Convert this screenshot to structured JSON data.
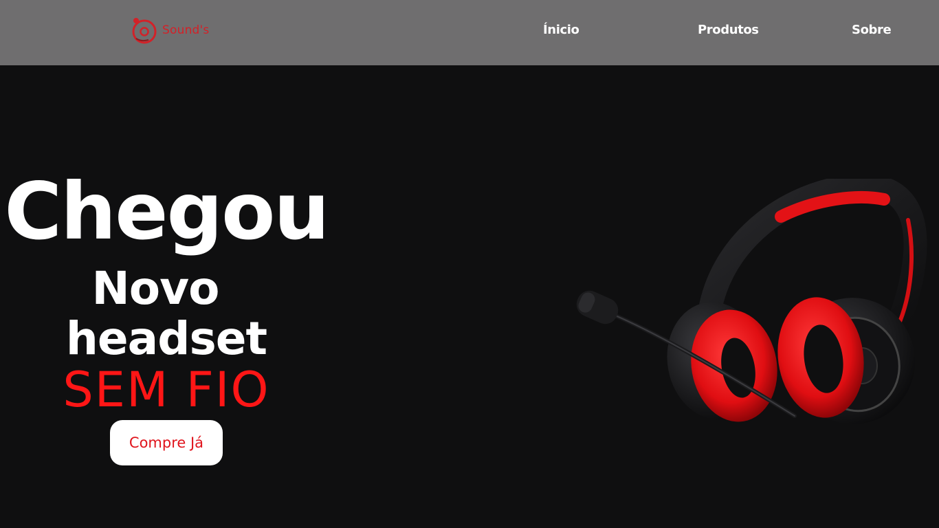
{
  "brand": {
    "name": "Sound's",
    "logo_icon": "record-circle-icon",
    "accent_color": "#d32128"
  },
  "nav": {
    "items": [
      {
        "label": "Ínicio"
      },
      {
        "label": "Produtos"
      },
      {
        "label": "Sobre"
      }
    ]
  },
  "hero": {
    "line1": "Chegou",
    "line2": "Novo",
    "line3": "headset",
    "line4": "SEM FIO",
    "line4_color": "#ff1616",
    "cta_label": "Compre Já",
    "image_icon": "headset-icon"
  },
  "colors": {
    "navbar_bg": "#6f6e6f",
    "page_bg": "#0f0f10",
    "cta_bg": "#ffffff",
    "cta_text": "#e0141c"
  }
}
